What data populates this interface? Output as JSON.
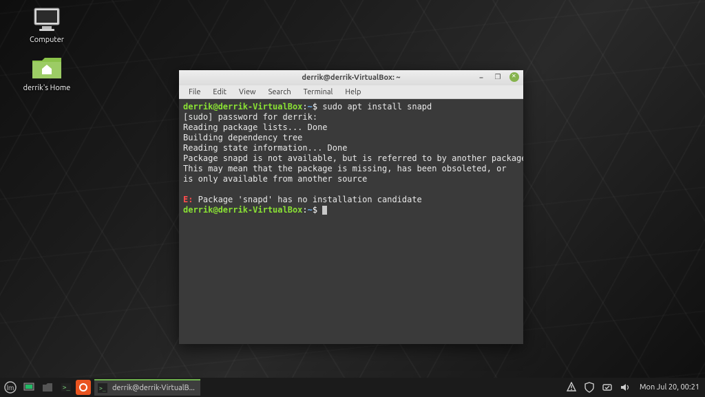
{
  "desktop": {
    "icons": [
      {
        "name": "computer-icon",
        "label": "Computer"
      },
      {
        "name": "home-folder-icon",
        "label": "derrik's Home"
      }
    ]
  },
  "window": {
    "title": "derrik@derrik-VirtualBox: ~",
    "menu": [
      "File",
      "Edit",
      "View",
      "Search",
      "Terminal",
      "Help"
    ],
    "controls": {
      "min": "–",
      "max": "❐",
      "close": ""
    }
  },
  "terminal": {
    "prompt1": {
      "userhost": "derrik@derrik-VirtualBox",
      "colon": ":",
      "path": "~",
      "dollar": "$"
    },
    "cmd1": " sudo apt install snapd",
    "lines": [
      "[sudo] password for derrik:",
      "Reading package lists... Done",
      "Building dependency tree",
      "Reading state information... Done",
      "Package snapd is not available, but is referred to by another package.",
      "This may mean that the package is missing, has been obsoleted, or",
      "is only available from another source",
      ""
    ],
    "err_prefix": "E:",
    "err_msg": " Package 'snapd' has no installation candidate",
    "prompt2": {
      "userhost": "derrik@derrik-VirtualBox",
      "colon": ":",
      "path": "~",
      "dollar": "$"
    }
  },
  "taskbar": {
    "task_label": "derrik@derrik-VirtualB...",
    "clock": "Mon Jul 20, 00:21"
  },
  "colors": {
    "accent_green": "#86b34d"
  }
}
